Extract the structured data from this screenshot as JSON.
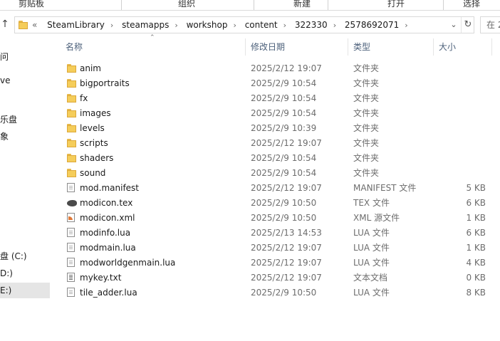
{
  "ribbon": {
    "groups": [
      "剪贴板",
      "组织",
      "新建",
      "打开",
      "选择"
    ]
  },
  "address": {
    "prefix": "«",
    "crumbs": [
      "SteamLibrary",
      "steamapps",
      "workshop",
      "content",
      "322330",
      "2578692071"
    ],
    "search_placeholder": "在 2"
  },
  "nav": {
    "items": [
      "问",
      "ve",
      "乐盘",
      "象",
      "盘 (C:)",
      "D:)",
      "E:)"
    ]
  },
  "columns": {
    "name": "名称",
    "date": "修改日期",
    "type": "类型",
    "size": "大小"
  },
  "files": [
    {
      "name": "anim",
      "date": "2025/2/12 19:07",
      "type": "文件夹",
      "size": "",
      "icon": "folder-icon"
    },
    {
      "name": "bigportraits",
      "date": "2025/2/9 10:54",
      "type": "文件夹",
      "size": "",
      "icon": "folder-icon"
    },
    {
      "name": "fx",
      "date": "2025/2/9 10:54",
      "type": "文件夹",
      "size": "",
      "icon": "folder-icon"
    },
    {
      "name": "images",
      "date": "2025/2/9 10:54",
      "type": "文件夹",
      "size": "",
      "icon": "folder-icon"
    },
    {
      "name": "levels",
      "date": "2025/2/9 10:39",
      "type": "文件夹",
      "size": "",
      "icon": "folder-icon"
    },
    {
      "name": "scripts",
      "date": "2025/2/12 19:07",
      "type": "文件夹",
      "size": "",
      "icon": "folder-icon"
    },
    {
      "name": "shaders",
      "date": "2025/2/9 10:54",
      "type": "文件夹",
      "size": "",
      "icon": "folder-icon"
    },
    {
      "name": "sound",
      "date": "2025/2/9 10:54",
      "type": "文件夹",
      "size": "",
      "icon": "folder-icon"
    },
    {
      "name": "mod.manifest",
      "date": "2025/2/12 19:07",
      "type": "MANIFEST 文件",
      "size": "5 KB",
      "icon": "document-icon"
    },
    {
      "name": "modicon.tex",
      "date": "2025/2/9 10:50",
      "type": "TEX 文件",
      "size": "6 KB",
      "icon": "texture-icon"
    },
    {
      "name": "modicon.xml",
      "date": "2025/2/9 10:50",
      "type": "XML 源文件",
      "size": "1 KB",
      "icon": "xml-icon"
    },
    {
      "name": "modinfo.lua",
      "date": "2025/2/13 14:53",
      "type": "LUA 文件",
      "size": "6 KB",
      "icon": "document-icon"
    },
    {
      "name": "modmain.lua",
      "date": "2025/2/12 19:07",
      "type": "LUA 文件",
      "size": "1 KB",
      "icon": "document-icon"
    },
    {
      "name": "modworldgenmain.lua",
      "date": "2025/2/12 19:07",
      "type": "LUA 文件",
      "size": "4 KB",
      "icon": "document-icon"
    },
    {
      "name": "mykey.txt",
      "date": "2025/2/12 19:07",
      "type": "文本文档",
      "size": "0 KB",
      "icon": "text-file-icon"
    },
    {
      "name": "tile_adder.lua",
      "date": "2025/2/9 10:50",
      "type": "LUA 文件",
      "size": "8 KB",
      "icon": "document-icon"
    }
  ]
}
